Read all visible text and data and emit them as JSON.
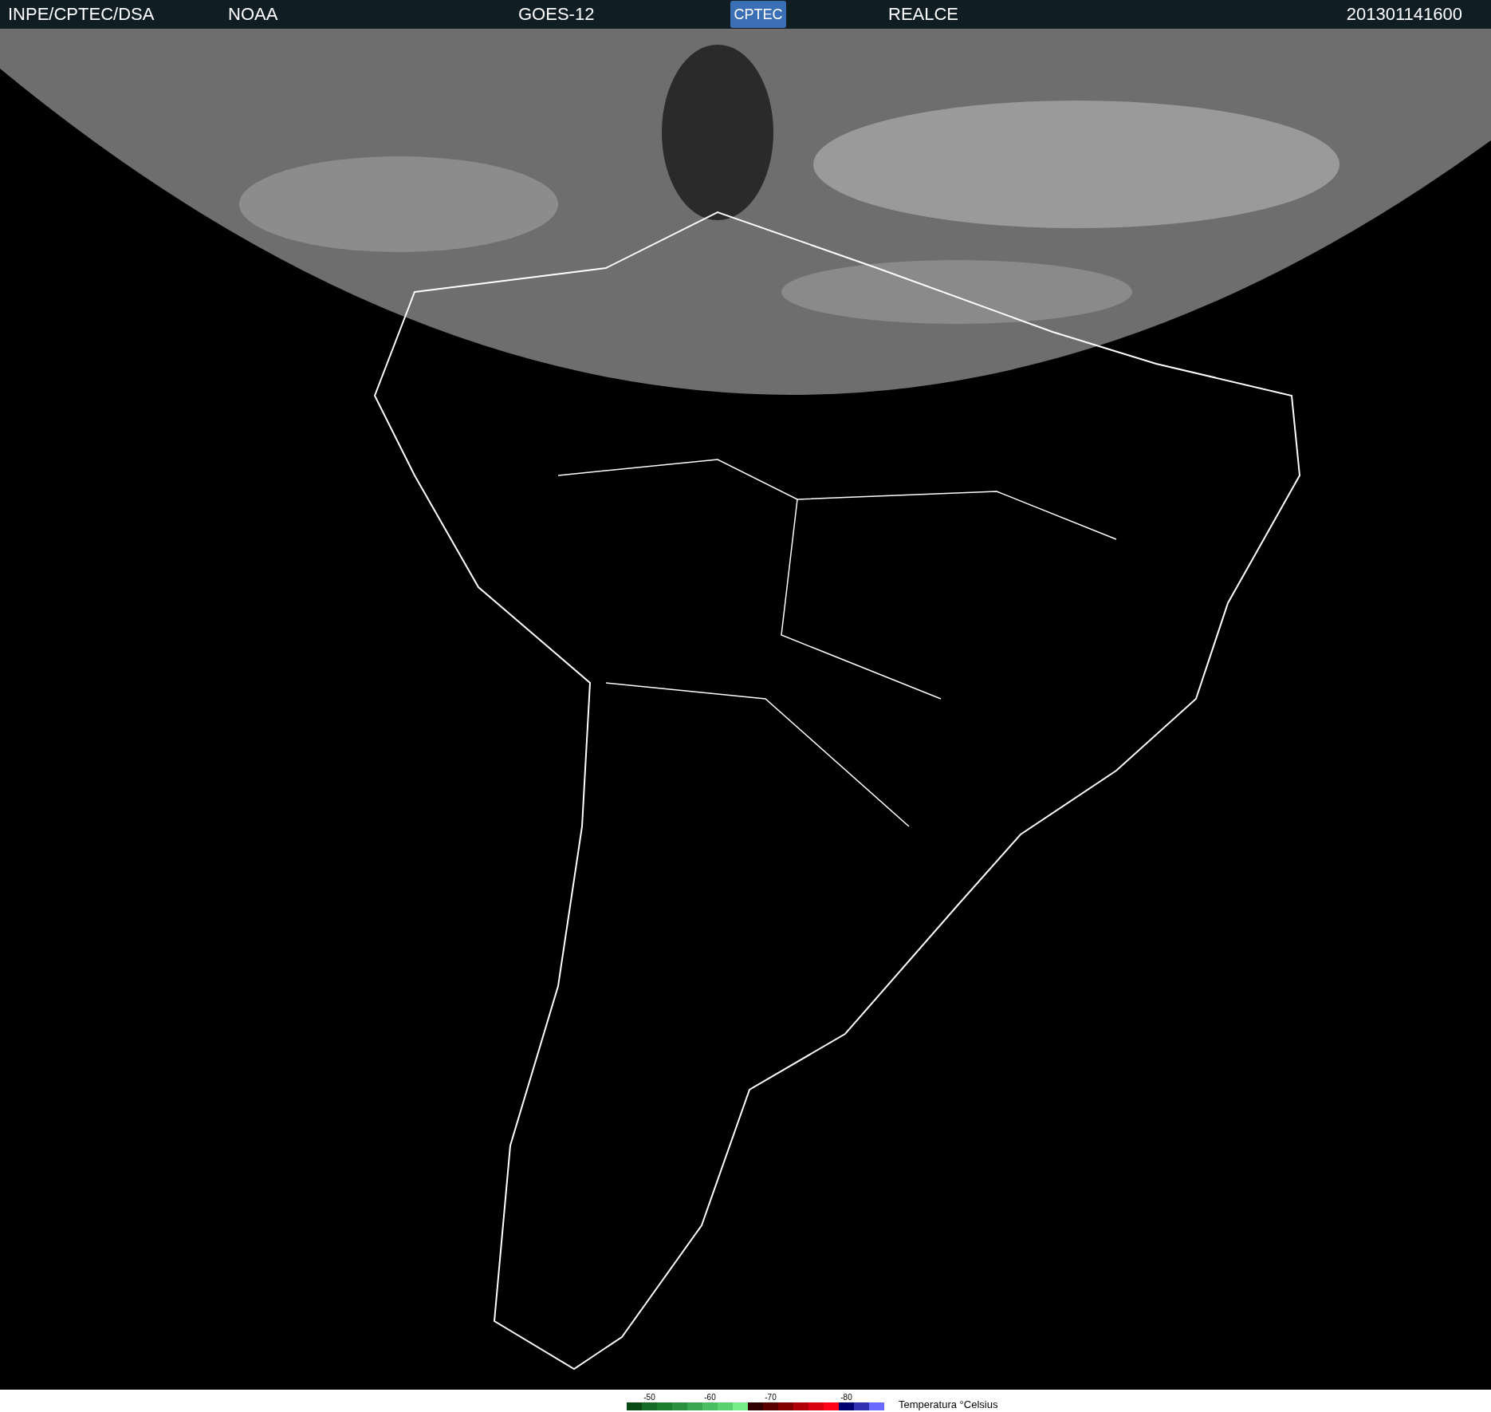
{
  "header": {
    "source": "INPE/CPTEC/DSA",
    "agency": "NOAA",
    "satellite": "GOES-12",
    "logo": "CPTEC",
    "product": "REALCE",
    "timestamp": "201301141600"
  },
  "legend": {
    "title": "Temperatura °Celsius",
    "swatches": [
      {
        "color": "#0a4a14"
      },
      {
        "color": "#146a24",
        "label": "-50"
      },
      {
        "color": "#1e7e30"
      },
      {
        "color": "#2a9040"
      },
      {
        "color": "#3aa650"
      },
      {
        "color": "#4cbe62",
        "label": "-60"
      },
      {
        "color": "#5cd070"
      },
      {
        "color": "#78ec88"
      },
      {
        "color": "#300000"
      },
      {
        "color": "#5a0000",
        "label": "-70"
      },
      {
        "color": "#800000"
      },
      {
        "color": "#b00008"
      },
      {
        "color": "#d80010"
      },
      {
        "color": "#ff0018"
      },
      {
        "color": "#000070",
        "label": "-80"
      },
      {
        "color": "#3030b0"
      },
      {
        "color": "#6a6aff"
      }
    ]
  }
}
